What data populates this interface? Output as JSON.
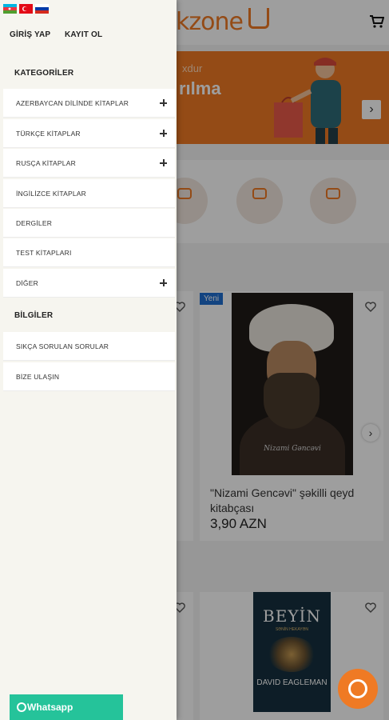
{
  "languages": [
    {
      "code": "az",
      "icon": "flag-azerbaijan-icon"
    },
    {
      "code": "tr",
      "icon": "flag-turkey-icon"
    },
    {
      "code": "ru",
      "icon": "flag-russia-icon"
    }
  ],
  "auth": {
    "login": "GİRİŞ YAP",
    "register": "KAYIT OL"
  },
  "categories": {
    "title": "KATEGORİLER",
    "items": [
      {
        "label": "AZERBAYCAN DİLİNDE KİTAPLAR",
        "expandable": true
      },
      {
        "label": "TÜRKÇE KİTAPLAR",
        "expandable": true
      },
      {
        "label": "RUSÇA KİTAPLAR",
        "expandable": true
      },
      {
        "label": "İNGİLİZCE KİTAPLAR",
        "expandable": false
      },
      {
        "label": "DERGİLER",
        "expandable": false
      },
      {
        "label": "TEST KİTAPLARI",
        "expandable": false
      },
      {
        "label": "DİĞER",
        "expandable": true
      }
    ]
  },
  "info": {
    "title": "BİLGİLER",
    "items": [
      {
        "label": "SIKÇA SORULAN SORULAR"
      },
      {
        "label": "BİZE ULAŞIN"
      }
    ]
  },
  "whatsapp": {
    "label": "Whatsapp",
    "icon": "whatsapp-icon"
  },
  "background": {
    "logo_text": "kzone",
    "banner": {
      "subtitle": "xdur",
      "title": "rılma"
    },
    "badge": "Yeni",
    "product": {
      "title": "\"Nizami Gencəvi\" şəkilli qeyd kitabçası",
      "price": "3,90 AZN",
      "cover_caption": "Nizami Gəncəvi"
    },
    "book2": {
      "title": "BEYİN",
      "subtitle": "SƏNİN HEKAYƏN",
      "author": "DAVID EAGLEMAN"
    },
    "colors": {
      "brand": "#ef7a24",
      "whatsapp": "#25c39a",
      "badge": "#1f6fd1"
    }
  }
}
